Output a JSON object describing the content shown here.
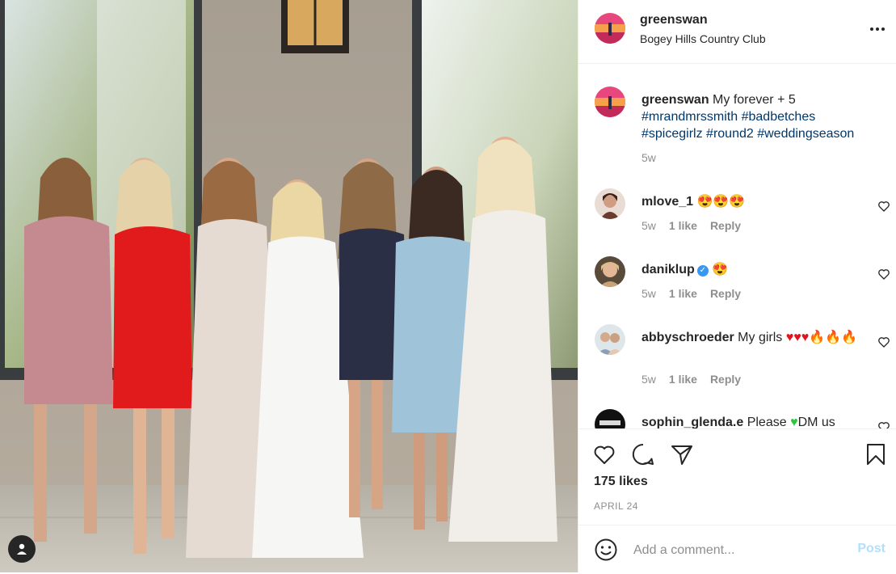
{
  "post": {
    "username": "greenswan",
    "location": "Bogey Hills Country Club",
    "caption_user": "greenswan",
    "caption_text": "My forever + 5",
    "hashtags": [
      "#mrandmrssmith",
      "#badbetches",
      "#spicegirlz",
      "#round2",
      "#weddingseason"
    ],
    "caption_time": "5w",
    "likes": "175 likes",
    "date": "APRIL 24"
  },
  "comments": [
    {
      "user": "mlove_1",
      "text": "😍😍😍",
      "verified": false,
      "time": "5w",
      "likes": "1 like",
      "reply": "Reply",
      "avatar_color": "#6b3b2e"
    },
    {
      "user": "daniklup",
      "text": "😍",
      "verified": true,
      "verified_mark": "✓",
      "time": "5w",
      "likes": "1 like",
      "reply": "Reply",
      "avatar_color": "#c9a27a"
    },
    {
      "user": "abbyschroeder",
      "text_prefix": "My girls",
      "text_hearts": "♥♥♥",
      "text_fire": "🔥🔥🔥",
      "time": "5w",
      "likes": "1 like",
      "reply": "Reply",
      "avatar_color": "#8aa0b8"
    },
    {
      "user": "sophin_glenda.e",
      "text_prefix": "Please",
      "text_heart": "♥",
      "text_suffix": "DM us",
      "avatar_color": "#111111"
    }
  ],
  "add_comment": {
    "placeholder": "Add a comment...",
    "post_label": "Post"
  },
  "icons": {
    "more": "more-options-icon",
    "heart": "heart-icon",
    "comment": "comment-icon",
    "share": "share-icon",
    "save": "bookmark-icon",
    "emoji": "emoji-icon",
    "user_tag": "user-tag-icon"
  },
  "colors": {
    "hashtag": "#00376b",
    "meta": "#8e8e8e",
    "post_disabled": "#b2dffc",
    "verified": "#3897f0"
  }
}
